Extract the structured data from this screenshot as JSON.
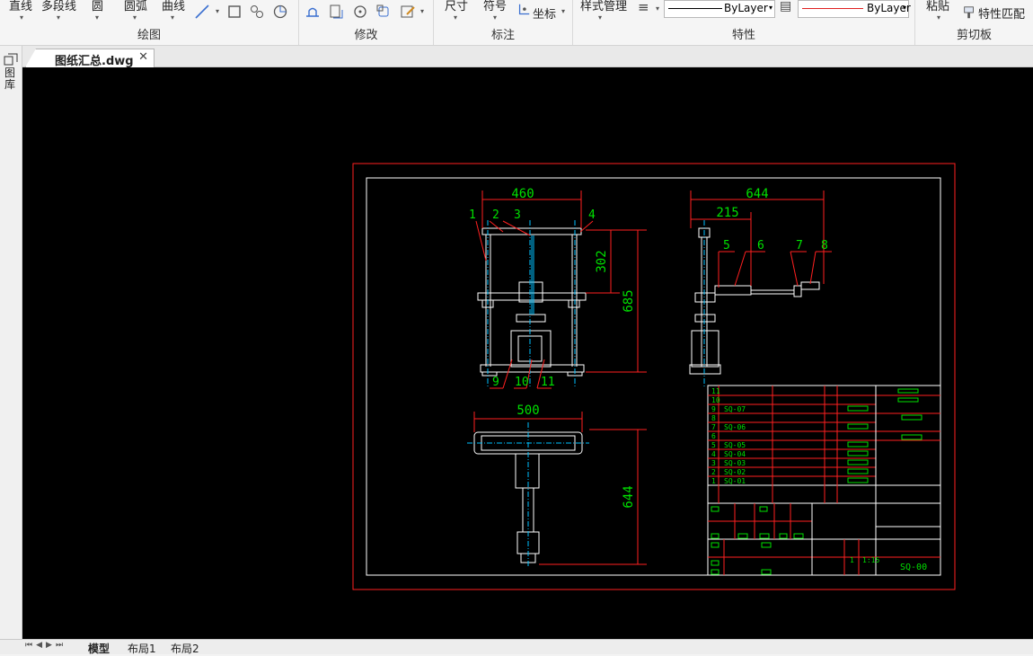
{
  "ribbon": {
    "draw": {
      "label": "绘图",
      "line": "直线",
      "polyline": "多段线",
      "circle": "圆",
      "arc": "圆弧",
      "curve": "曲线"
    },
    "modify": {
      "label": "修改"
    },
    "annotate": {
      "label": "标注",
      "dimension": "尺寸",
      "symbol": "符号",
      "coordinate": "坐标"
    },
    "properties": {
      "label": "特性",
      "style_manager": "样式管理",
      "linetype": "ByLayer",
      "lineweight": "ByLayer"
    },
    "clipboard": {
      "label": "剪切板",
      "paste": "粘贴",
      "match": "特性匹配"
    }
  },
  "document": {
    "tab_title": "图纸汇总.dwg"
  },
  "left_strip": {
    "label": "图库"
  },
  "layout_tabs": [
    "模型",
    "布局1",
    "布局2"
  ],
  "drawing": {
    "dims": {
      "top_width": "460",
      "side_width": "644",
      "side_offset": "215",
      "upper_height": "302",
      "front_height": "685",
      "plan_width": "500",
      "plan_height": "644"
    },
    "balloons": [
      "1",
      "2",
      "3",
      "4",
      "5",
      "6",
      "7",
      "8",
      "9",
      "10",
      "11"
    ],
    "bom": {
      "item_numbers": [
        "11",
        "10",
        "9",
        "8",
        "7",
        "6",
        "5",
        "4",
        "3",
        "2",
        "1"
      ],
      "part_codes": [
        "SQ-07",
        "SQ-06",
        "SQ-05",
        "SQ-04",
        "SQ-03",
        "SQ-02",
        "SQ-01"
      ],
      "drawing_no": "SQ-00",
      "scale": "1:15",
      "count": "1"
    }
  },
  "colors": {
    "canvas": "#000000",
    "frame": "#ff2020",
    "dim": "#00e000",
    "geom": "#ffffff",
    "accent": "#00c0ff"
  }
}
